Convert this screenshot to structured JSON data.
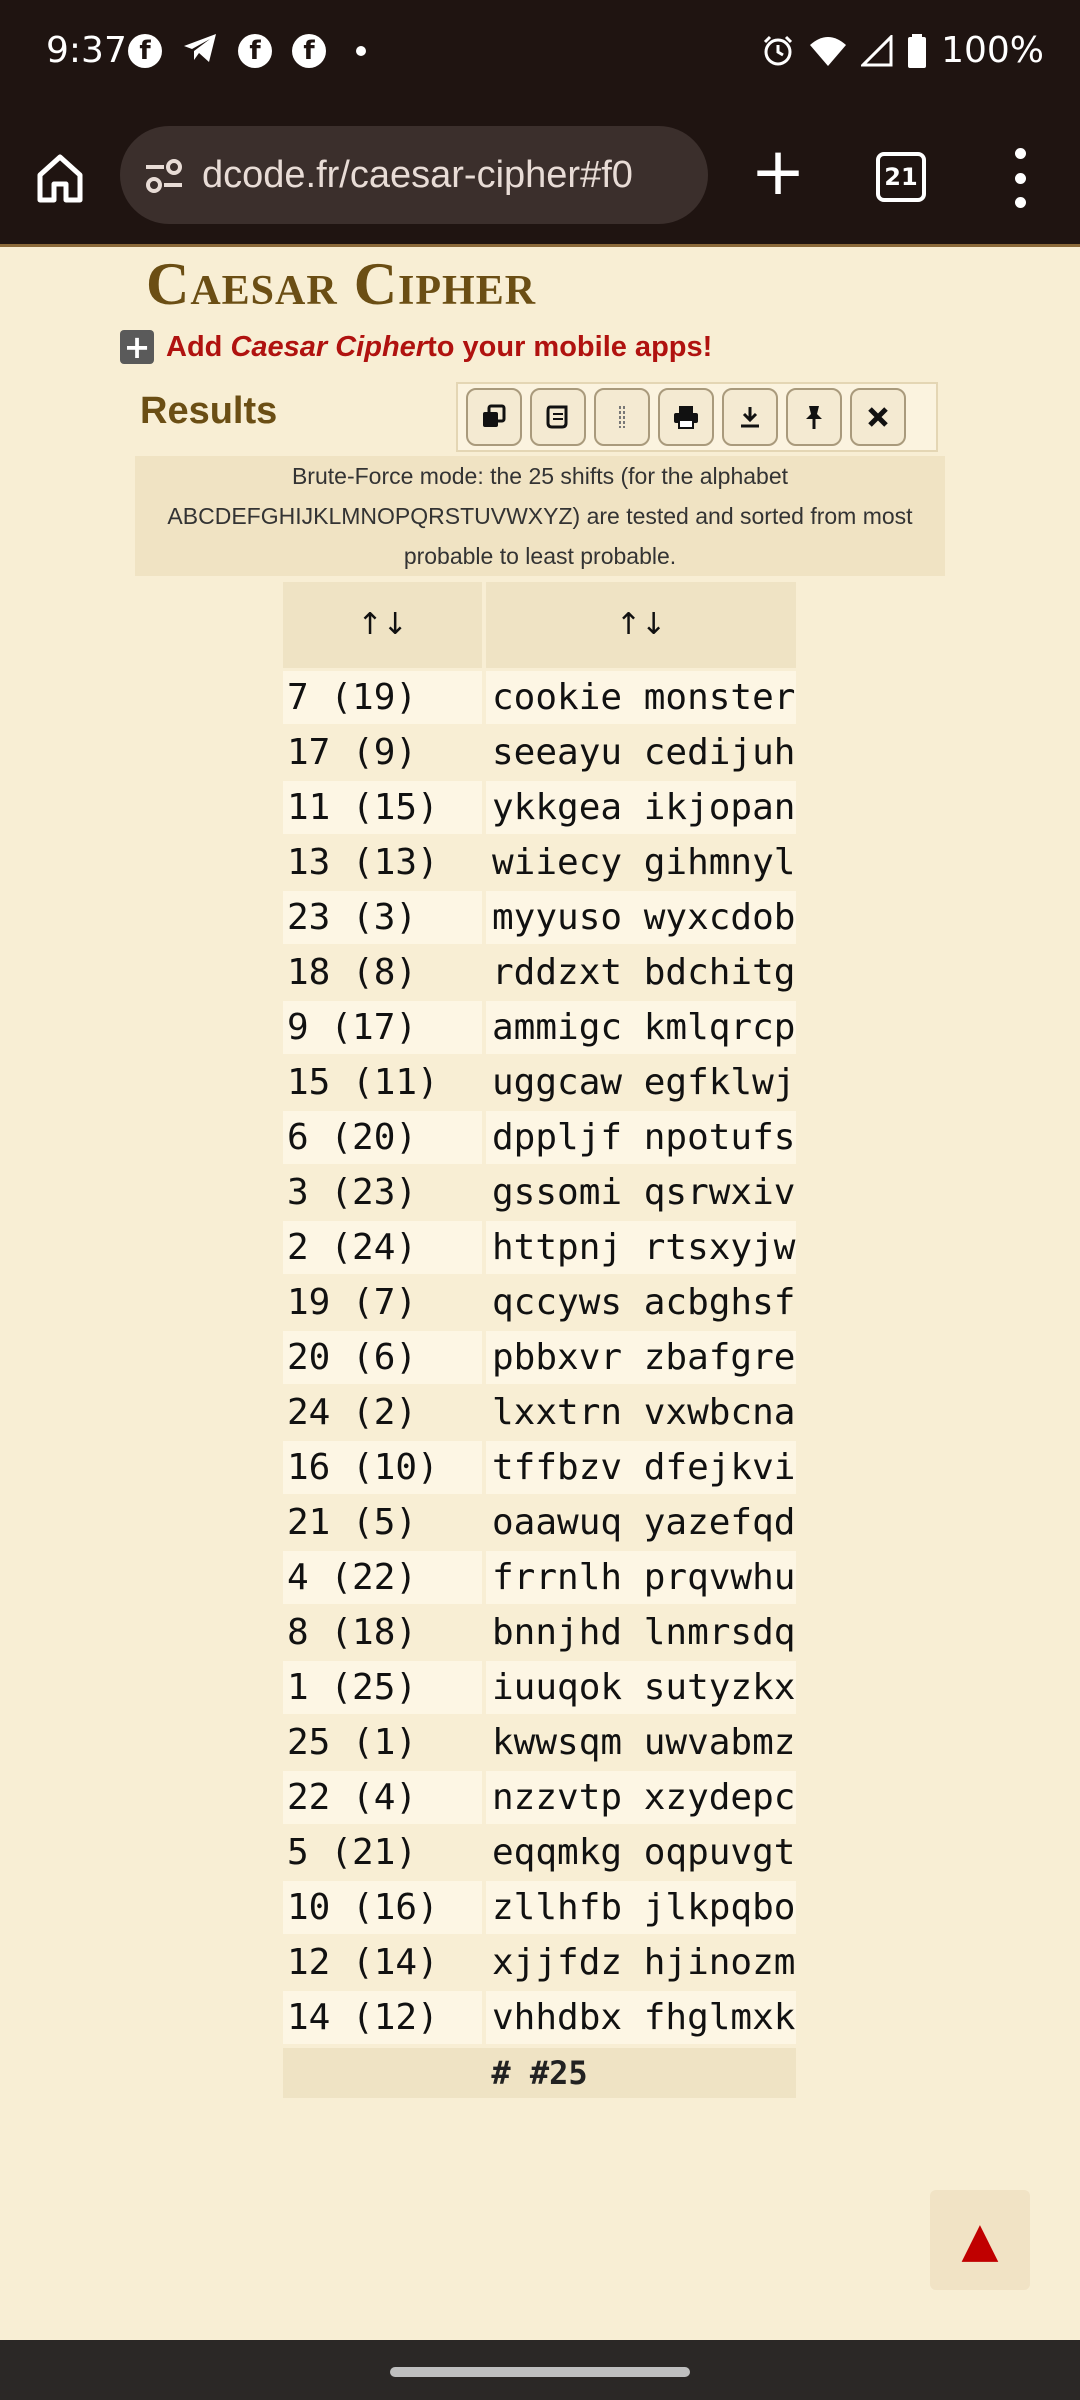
{
  "status_bar": {
    "time": "9:37",
    "battery": "100%",
    "left_icons": [
      "facebook-icon",
      "telegram-icon",
      "facebook-icon",
      "facebook-icon",
      "dot-icon"
    ],
    "right_icons": [
      "alarm-icon",
      "wifi-icon",
      "signal-icon",
      "battery-icon"
    ]
  },
  "browser": {
    "url": "dcode.fr/caesar-cipher#f0",
    "tab_count": "21"
  },
  "page": {
    "title": "Caesar Cipher",
    "add_prefix": "Add ",
    "add_em": "Caesar Cipher",
    "add_suffix": " to your mobile apps!",
    "results_label": "Results",
    "info": "Brute-Force mode: the 25 shifts (for the alphabet ABCDEFGHIJKLMNOPQRSTUVWXYZ) are tested and sorted from most probable to least probable.",
    "sort_header_1": "↑↓",
    "sort_header_2": "↑↓",
    "footer": "# #25"
  },
  "toolbar": {
    "buttons": [
      "copy-icon",
      "scroll-icon",
      "split-icon",
      "print-icon",
      "download-icon",
      "pin-icon",
      "close-icon"
    ]
  },
  "table": {
    "rows": [
      {
        "shift": "7 (19)",
        "text": "cookie monster"
      },
      {
        "shift": "17 (9)",
        "text": "seeayu cedijuh"
      },
      {
        "shift": "11 (15)",
        "text": "ykkgea ikjopan"
      },
      {
        "shift": "13 (13)",
        "text": "wiiecy gihmnyl"
      },
      {
        "shift": "23 (3)",
        "text": "myyuso wyxcdob"
      },
      {
        "shift": "18 (8)",
        "text": "rddzxt bdchitg"
      },
      {
        "shift": "9 (17)",
        "text": "ammigc kmlqrcp"
      },
      {
        "shift": "15 (11)",
        "text": "uggcaw egfklwj"
      },
      {
        "shift": "6 (20)",
        "text": "dppljf npotufs"
      },
      {
        "shift": "3 (23)",
        "text": "gssomi qsrwxiv"
      },
      {
        "shift": "2 (24)",
        "text": "httpnj rtsxyjw"
      },
      {
        "shift": "19 (7)",
        "text": "qccyws acbghsf"
      },
      {
        "shift": "20 (6)",
        "text": "pbbxvr zbafgre"
      },
      {
        "shift": "24 (2)",
        "text": "lxxtrn vxwbcna"
      },
      {
        "shift": "16 (10)",
        "text": "tffbzv dfejkvi"
      },
      {
        "shift": "21 (5)",
        "text": "oaawuq yazefqd"
      },
      {
        "shift": "4 (22)",
        "text": "frrnlh prqvwhu"
      },
      {
        "shift": "8 (18)",
        "text": "bnnjhd lnmrsdq"
      },
      {
        "shift": "1 (25)",
        "text": "iuuqok sutyzkx"
      },
      {
        "shift": "25 (1)",
        "text": "kwwsqm uwvabmz"
      },
      {
        "shift": "22 (4)",
        "text": "nzzvtp xzydepc"
      },
      {
        "shift": "5 (21)",
        "text": "eqqmkg oqpuvgt"
      },
      {
        "shift": "10 (16)",
        "text": "zllhfb jlkpqbo"
      },
      {
        "shift": "12 (14)",
        "text": "xjjfdz hjinozm"
      },
      {
        "shift": "14 (12)",
        "text": "vhhdbx fhglmxk"
      }
    ]
  },
  "back_to_top": "▲"
}
